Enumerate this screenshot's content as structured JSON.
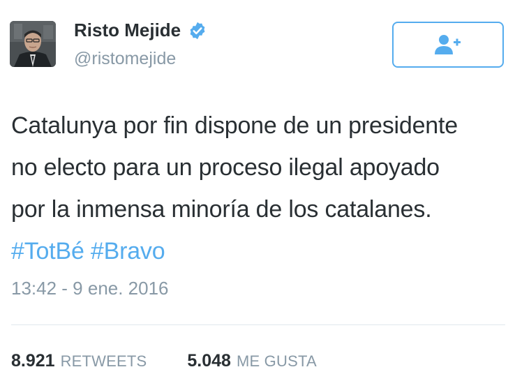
{
  "tweet": {
    "author": {
      "display_name": "Risto Mejide",
      "handle": "@ristomejide",
      "verified": true,
      "avatar_icon": "profile-photo"
    },
    "follow_button": {
      "icon": "add-user-icon"
    },
    "text_lines": [
      "Catalunya por fin dispone de un presidente",
      "no electo para un proceso ilegal apoyado",
      "por la inmensa minoría de los catalanes."
    ],
    "hashtags": [
      "#TotBé",
      "#Bravo"
    ],
    "timestamp": "13:42 - 9 ene. 2016",
    "stats": {
      "retweets_count": "8.921",
      "retweets_label": "RETWEETS",
      "likes_count": "5.048",
      "likes_label": "ME GUSTA"
    }
  },
  "colors": {
    "accent": "#55acee",
    "text": "#292f33",
    "muted": "#8899a6",
    "divider": "#e1e8ed"
  }
}
